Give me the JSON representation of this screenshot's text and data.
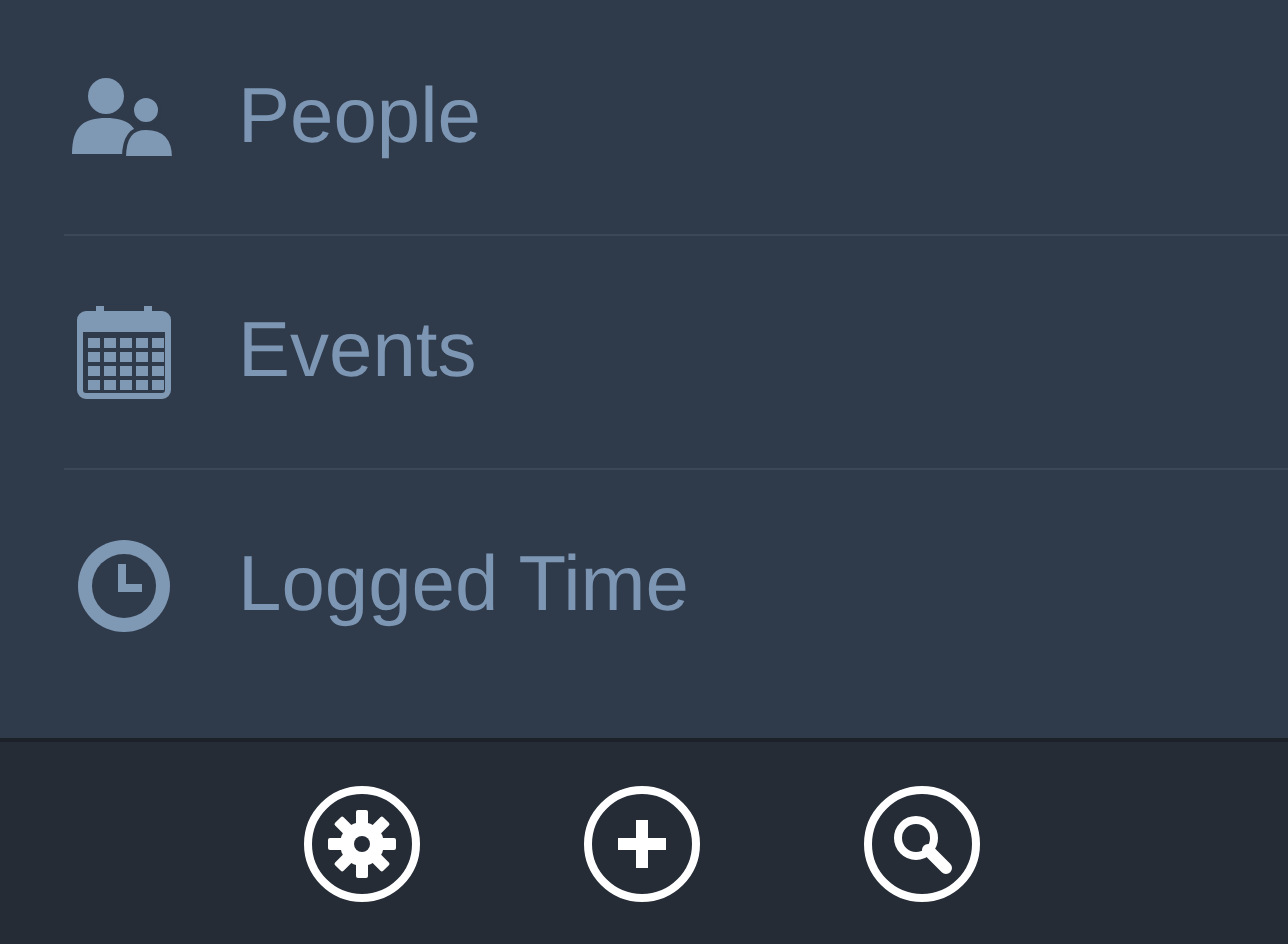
{
  "menu": [
    {
      "label": "People",
      "kind": "people"
    },
    {
      "label": "Events",
      "kind": "calendar"
    },
    {
      "label": "Logged Time",
      "kind": "clock"
    }
  ],
  "toolbar": [
    {
      "kind": "settings"
    },
    {
      "kind": "add"
    },
    {
      "kind": "search"
    }
  ]
}
